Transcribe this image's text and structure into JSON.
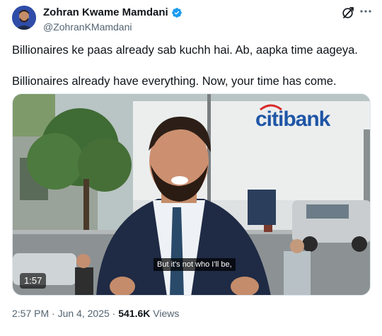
{
  "author": {
    "display_name": "Zohran Kwame Mamdani",
    "handle": "@ZohranKMamdani"
  },
  "icons": {
    "verified": "verified-badge-icon",
    "grok": "grok-icon",
    "more": "more-options-icon"
  },
  "tweet": {
    "line1": "Billionaires ke paas already sab kuchh hai. Ab, aapka time aageya.",
    "line2": "Billionaires already have everything. Now, your time has come."
  },
  "video": {
    "sign_text": "citibank",
    "subtitle": "But it's not who I'll be,",
    "duration": "1:57"
  },
  "meta": {
    "time": "2:57 PM",
    "separator": "·",
    "date": "Jun 4, 2025",
    "views_count": "541.6K",
    "views_label": "Views"
  },
  "colors": {
    "verified_blue": "#1d9bf0",
    "text_primary": "#0f1419",
    "text_secondary": "#536471",
    "citibank_blue": "#1f56a6"
  }
}
